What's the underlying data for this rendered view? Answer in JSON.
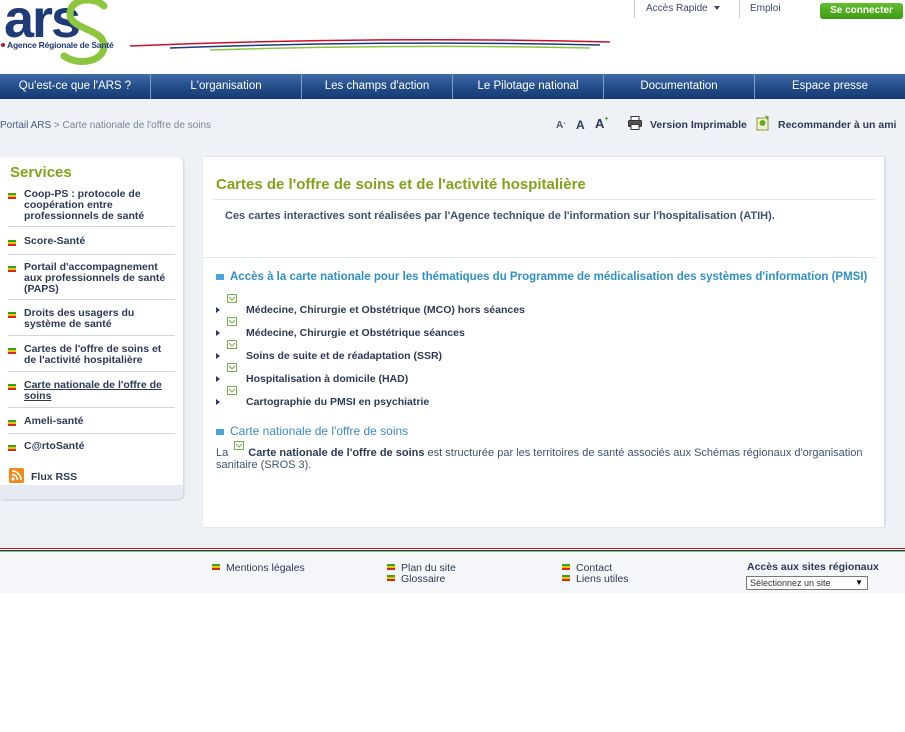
{
  "header": {
    "logo_text": "ars",
    "agency_name": "Agence Régionale de Santé",
    "quick_access_label": "Accès Rapide",
    "job_label": "Emploi",
    "login_label": "Se connecter"
  },
  "nav": {
    "items": [
      {
        "label": "Qu'est-ce que l'ARS ?"
      },
      {
        "label": "L'organisation"
      },
      {
        "label": "Les champs d'action"
      },
      {
        "label": "Le Pilotage national"
      },
      {
        "label": "Documentation"
      },
      {
        "label": "Espace presse"
      }
    ]
  },
  "breadcrumb": {
    "home": "Portail ARS",
    "separator": ">",
    "current": "Carte nationale de l'offre de soins"
  },
  "tools": {
    "font_small": "A",
    "font_small_sup": "-",
    "font_normal": "A",
    "font_large": "A",
    "font_large_sup": "+",
    "print_label": "Version Imprimable",
    "recommend_label": "Recommander à un ami"
  },
  "sidebar": {
    "title": "Services",
    "items": [
      {
        "label": "Coop-PS : protocole de coopération entre professionnels de santé"
      },
      {
        "label": "Score-Santé"
      },
      {
        "label": "Portail d'accompagnement aux professionnels de santé (PAPS)"
      },
      {
        "label": "Droits des usagers du système de santé"
      },
      {
        "label": "Cartes de l'offre de soins et de l'activité hospitalière"
      },
      {
        "label": "Carte nationale de l'offre de soins"
      },
      {
        "label": "Ameli-santé"
      },
      {
        "label": "C@rtoSanté"
      }
    ],
    "rss_label": "Flux RSS"
  },
  "content": {
    "title": "Cartes de l'offre de soins et de l'activité hospitalière",
    "intro": "Ces cartes interactives sont réalisées par l'Agence technique de l'information sur l'hospitalisation (ATIH).",
    "section1_title": "Accès à la carte nationale pour les thématiques du Programme de médicalisation des systèmes d'information (PMSI)",
    "pmsi_items": [
      {
        "label": "Médecine, Chirurgie et Obstétrique (MCO) hors séances"
      },
      {
        "label": "Médecine, Chirurgie et Obstétrique séances"
      },
      {
        "label": "Soins de suite et de réadaptation (SSR)"
      },
      {
        "label": "Hospitalisation à domicile (HAD)"
      },
      {
        "label": "Cartographie du PMSI en psychiatrie"
      }
    ],
    "section2_title": "Carte nationale de l'offre de soins",
    "desc_prefix": "La",
    "desc_link": "Carte nationale de l'offre de soins",
    "desc_suffix": "est structurée par les territoires de santé associés aux Schémas régionaux d'organisation sanitaire (SROS 3)."
  },
  "footer": {
    "legal": "Mentions légales",
    "sitemap": "Plan du site",
    "glossary": "Glossaire",
    "contact": "Contact",
    "links": "Liens utiles",
    "region_title": "Accès aux sites régionaux",
    "region_select": "Sélectionnez un site"
  },
  "colors": {
    "nav_blue": "#244e8a",
    "title_green": "#7ea51a",
    "link_blue": "#2f8fca",
    "button_green": "#4caf20"
  }
}
